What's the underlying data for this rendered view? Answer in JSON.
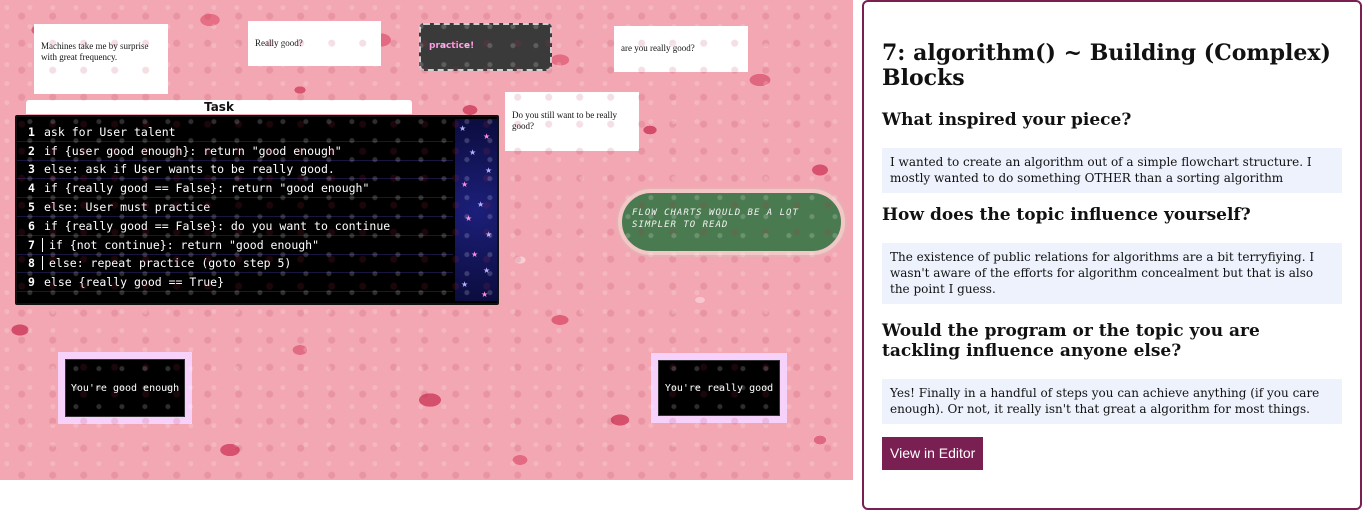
{
  "canvas": {
    "notes": [
      "Machines take me by surprise with great frequency.",
      "Really good?",
      "are you really good?",
      "Do you still want to be really good?"
    ],
    "practice_label": "practice!",
    "task_title": "Task",
    "code_lines": [
      {
        "num": "1",
        "text": "ask for User talent"
      },
      {
        "num": "2",
        "text": "if {user good enough}: return \"good enough\""
      },
      {
        "num": "3",
        "text": "else: ask if User wants to be really good."
      },
      {
        "num": "4",
        "text": "if {really good == False}: return \"good enough\""
      },
      {
        "num": "5",
        "text": "else: User must practice"
      },
      {
        "num": "6",
        "text": "if {really good == False}: do you want to continue"
      },
      {
        "num": "7",
        "text": " if {not continue}: return \"good enough\""
      },
      {
        "num": "8",
        "text": "else: repeat practice (goto step 5)"
      },
      {
        "num": "9",
        "text": "else {really good == True}"
      }
    ],
    "flow_button_label": "Flow charts would be a lot simpler to read",
    "result_cards": [
      "You're good enough",
      "You're really good"
    ],
    "colors": {
      "sponge": "#f2a7b3",
      "button_green": "#4a7b50",
      "card_border": "#f6d2fa"
    }
  },
  "panel": {
    "title": "7: algorithm() ~ Building (Complex) Blocks",
    "questions": [
      {
        "q": "What inspired your piece?",
        "a": "I wanted to create an algorithm out of a simple flowchart structure. I mostly wanted to do something OTHER than a sorting algorithm"
      },
      {
        "q": "How does the topic influence yourself?",
        "a": "The existence of public relations for algorithms are a bit terryfiying. I wasn't aware of the efforts for algorithm concealment but that is also the point I guess."
      },
      {
        "q": "Would the program or the topic you are tackling influence anyone else?",
        "a": "Yes! Finally in a handful of steps you can achieve anything (if you care enough). Or not, it really isn't that great a algorithm for most things."
      }
    ],
    "editor_button": "View in Editor",
    "colors": {
      "accent": "#7a1f52",
      "answer_bg": "#eef2fd"
    }
  }
}
